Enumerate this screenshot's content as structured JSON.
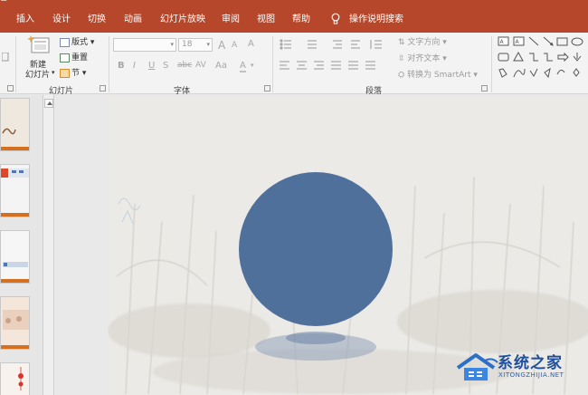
{
  "titlebar": {
    "fragment": "≡"
  },
  "tabs": [
    {
      "label": "插入"
    },
    {
      "label": "设计"
    },
    {
      "label": "切换"
    },
    {
      "label": "动画"
    },
    {
      "label": "幻灯片放映"
    },
    {
      "label": "审阅"
    },
    {
      "label": "视图"
    },
    {
      "label": "帮助"
    }
  ],
  "tell_me": {
    "label": "操作说明搜索"
  },
  "slides_group": {
    "new_slide_line1": "新建",
    "new_slide_line2": "幻灯片",
    "layout": "版式",
    "reset": "重置",
    "section": "节",
    "label": "幻灯片"
  },
  "font_group": {
    "font_name": "",
    "font_size": "18",
    "bold": "B",
    "italic": "I",
    "underline": "U",
    "shadow": "S",
    "strike": "abc",
    "spacing": "AV",
    "case": "Aa",
    "grow": "A",
    "shrink": "A",
    "clear": "A",
    "label": "字体"
  },
  "paragraph_group": {
    "text_direction": "文字方向",
    "align_text": "对齐文本",
    "smartart": "转换为 SmartArt",
    "label": "段落"
  },
  "watermark": {
    "main": "系统之家",
    "sub": "XITONGZHIJIA.NET"
  },
  "colors": {
    "ribbon_accent": "#b7472a",
    "shape_fill": "#50709c",
    "shadow": "#8094b4"
  }
}
